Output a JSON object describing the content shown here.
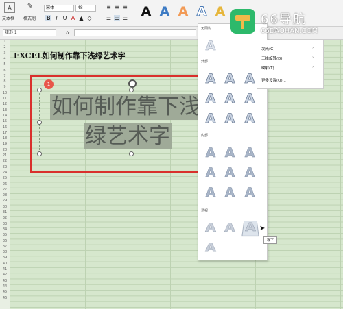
{
  "ribbon": {
    "textbox_label": "文本框",
    "format_painter_label": "格式刷",
    "font_name": "宋体",
    "font_size": "48",
    "style_letter": "A"
  },
  "formula_bar": {
    "name_box": "矩形 1",
    "fx": "fx"
  },
  "sheet": {
    "title": "EXCEL如何制作靠下浅绿艺术字",
    "row_numbers": [
      "1",
      "2",
      "3",
      "4",
      "5",
      "6",
      "7",
      "8",
      "9",
      "10",
      "11",
      "12",
      "13",
      "14",
      "15",
      "16",
      "17",
      "18",
      "19",
      "20",
      "21",
      "22",
      "23",
      "24",
      "25",
      "26",
      "27",
      "28",
      "29",
      "30",
      "31",
      "32",
      "33",
      "34",
      "35",
      "36",
      "37",
      "38",
      "39",
      "40",
      "41",
      "42",
      "43",
      "44",
      "45",
      "46"
    ],
    "wordart_line1": "如何制作靠下浅",
    "wordart_line2": "绿艺术字",
    "badge": "1"
  },
  "dropdown": {
    "section_none": "无阴影",
    "section_outer": "外部",
    "section_inner": "内部",
    "section_perspective": "透视",
    "glyph": "A",
    "tooltip": "靠下"
  },
  "submenu": {
    "items": [
      "发光(G)",
      "三维旋转(D)",
      "映射(T)",
      "更多设置(O)..."
    ]
  },
  "logo": {
    "title": "66导航",
    "url": "66DAOHAN.COM"
  },
  "colors": {
    "accent_red": "#d9302c",
    "logo_green": "#2db96b",
    "sheet_bg": "#d6e7cd"
  }
}
